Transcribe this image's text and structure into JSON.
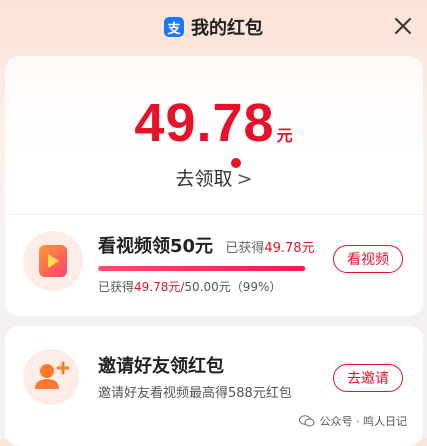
{
  "header": {
    "title": "我的红包",
    "brand_icon": "alipay-icon",
    "close_icon": "close-icon"
  },
  "balance": {
    "amount": "49.78",
    "unit": "元"
  },
  "claim": {
    "label": "去领取",
    "chevron": ">"
  },
  "task": {
    "title": "看视频领50元",
    "earned_prefix": "已获得",
    "earned_value": "49.78元",
    "progress_percent": 99,
    "detail_prefix": "已获得",
    "detail_value": "49.78元",
    "detail_suffix": "/50.00元（99%）",
    "button": "看视频",
    "icon": "video-play-icon"
  },
  "invite": {
    "title": "邀请好友领红包",
    "desc": "邀请好友看视频最高得588元红包",
    "button": "去邀请",
    "icon": "add-friend-icon"
  },
  "watermark": {
    "text": "公众号 · 鸣人日记",
    "icon": "wechat-icon"
  },
  "colors": {
    "accent": "#e4132b",
    "brand": "#1677ff"
  }
}
